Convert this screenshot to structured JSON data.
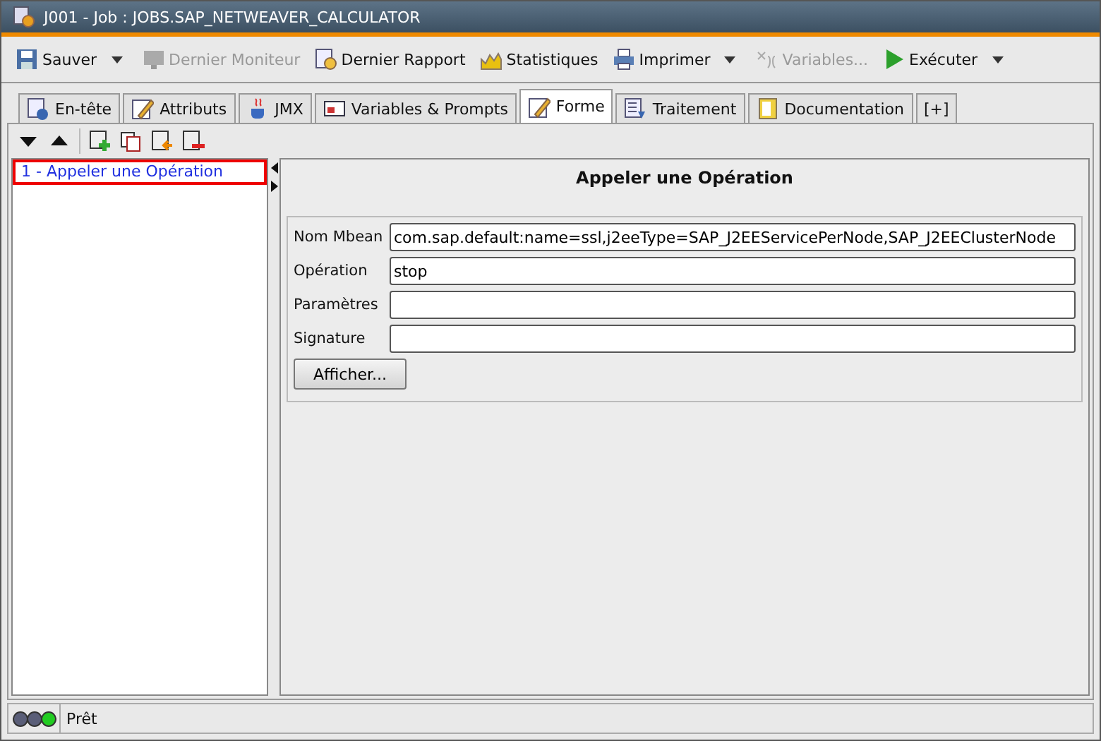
{
  "window": {
    "title": "J001 - Job : JOBS.SAP_NETWEAVER_CALCULATOR"
  },
  "toolbar": [
    {
      "label": "Sauver",
      "kind": "save",
      "disabled": false,
      "dropdown": true
    },
    {
      "label": "Dernier Moniteur",
      "kind": "monitor",
      "disabled": true,
      "dropdown": false
    },
    {
      "label": "Dernier Rapport",
      "kind": "report",
      "disabled": false,
      "dropdown": false
    },
    {
      "label": "Statistiques",
      "kind": "stats",
      "disabled": false,
      "dropdown": false
    },
    {
      "label": "Imprimer",
      "kind": "print",
      "disabled": false,
      "dropdown": true
    },
    {
      "label": "Variables...",
      "kind": "variables",
      "disabled": true,
      "dropdown": false
    },
    {
      "label": "Exécuter",
      "kind": "run",
      "disabled": false,
      "dropdown": true
    }
  ],
  "tabs": [
    {
      "label": "En-tête",
      "kind": "info",
      "selected": false
    },
    {
      "label": "Attributs",
      "kind": "edit",
      "selected": false
    },
    {
      "label": "JMX",
      "kind": "cup",
      "selected": false
    },
    {
      "label": "Variables & Prompts",
      "kind": "vars",
      "selected": false
    },
    {
      "label": "Forme",
      "kind": "edit",
      "selected": true
    },
    {
      "label": "Traitement",
      "kind": "list",
      "selected": false
    },
    {
      "label": "Documentation",
      "kind": "book",
      "selected": false
    },
    {
      "label": "[+]",
      "kind": "add",
      "selected": false
    }
  ],
  "steps": [
    {
      "label": "1 - Appeler une Opération",
      "selected": true
    }
  ],
  "form": {
    "heading": "Appeler une Opération",
    "fields": [
      {
        "label": "Nom Mbean",
        "value": "com.sap.default:name=ssl,j2eeType=SAP_J2EEServicePerNode,SAP_J2EEClusterNode"
      },
      {
        "label": "Opération",
        "value": "stop"
      },
      {
        "label": "Paramètres"
      },
      {
        "label": "Signature"
      }
    ],
    "button": "Afficher..."
  },
  "status_bar": {
    "lights": [
      {
        "color": "#5a5e78"
      },
      {
        "color": "#5a5e78"
      },
      {
        "color": "#22cc22"
      }
    ],
    "text": "Prêt"
  }
}
